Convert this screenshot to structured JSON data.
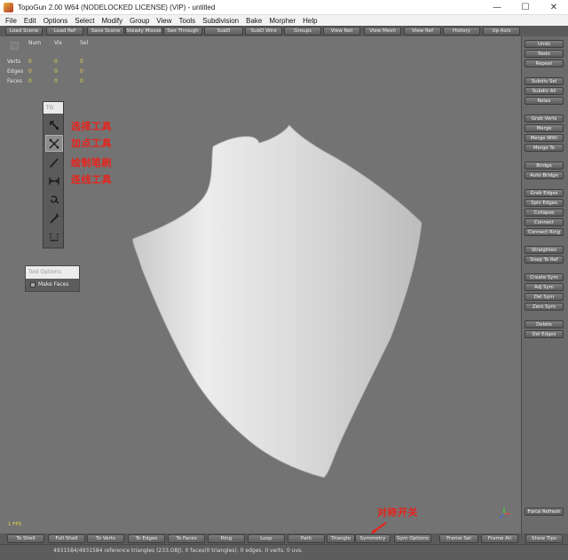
{
  "window": {
    "title": "TopoGun 2.00 W64  (NODELOCKED LICENSE) (VIP) - untitled",
    "controls": [
      "—",
      "☐",
      "✕"
    ]
  },
  "menu": [
    "File",
    "Edit",
    "Options",
    "Select",
    "Modify",
    "Group",
    "View",
    "Tools",
    "Subdivision",
    "Bake",
    "Morpher",
    "Help"
  ],
  "top_toolbar": [
    "Load Scene",
    "Load Ref",
    "Save Scene",
    "Steady Mouse",
    "See Through",
    "SubD",
    "SubD Wire",
    "Groups",
    "View Net",
    "View Mesh",
    "View Ref",
    "History",
    "Up Axis"
  ],
  "stats": {
    "headers": [
      "Num",
      "Vis",
      "Sel"
    ],
    "rows": [
      {
        "label": "Verts",
        "num": "0",
        "vis": "0",
        "sel": "0"
      },
      {
        "label": "Edges",
        "num": "0",
        "vis": "0",
        "sel": "0"
      },
      {
        "label": "Faces",
        "num": "0",
        "vis": "0",
        "sel": "0"
      }
    ]
  },
  "tool_palette": {
    "header": "TG",
    "tools": [
      {
        "icon": "select-tool-icon"
      },
      {
        "icon": "edit-tool-icon"
      },
      {
        "icon": "draw-tool-icon"
      },
      {
        "icon": "bridge-tool-icon"
      },
      {
        "icon": "brush-tool-icon"
      },
      {
        "icon": "extrude-tool-icon"
      },
      {
        "icon": "tubes-tool-icon"
      }
    ]
  },
  "annotations": {
    "select_tool": "选择工具",
    "add_point_tool": "加点工具",
    "draw_brush": "绘制笔刷",
    "bridge_tool": "连线工具",
    "symmetry_switch": "对称开关"
  },
  "tool_options": {
    "header": "Tool Options",
    "make_faces": "Make Faces"
  },
  "fps": "1 FPS",
  "right_panel": [
    "Undo",
    "Redo",
    "Repeat",
    "Subdiv Sel",
    "Subdiv All",
    "Relax",
    "Grab Verts",
    "Merge",
    "Merge With",
    "Merge To",
    "Bridge",
    "Auto Bridge",
    "Grab Edges",
    "Spin Edges",
    "Collapse",
    "Connect",
    "Connect Ring",
    "Straighten",
    "Snap To Ref",
    "Create Sym",
    "Adj Sym",
    "Del Sym",
    "Zero Sym",
    "Delete",
    "Del Edges",
    "Force Refresh"
  ],
  "bottom_toolbar": [
    "To Shell",
    "Full Shell",
    "To Verts",
    "To Edges",
    "To Faces",
    "Ring",
    "Loop",
    "Path",
    "Triangle",
    "Symmetry",
    "Sym Options",
    "Frame Sel",
    "Frame All",
    "Show Tips"
  ],
  "status": "4931584/4931584 reference triangles (233.OBJ). 0 faces(0 triangles). 0 edges. 0 verts. 0 uvs.",
  "colors": {
    "viewport": "#737373",
    "stat_values": "#e6d64a",
    "annotation": "#e8231b"
  }
}
